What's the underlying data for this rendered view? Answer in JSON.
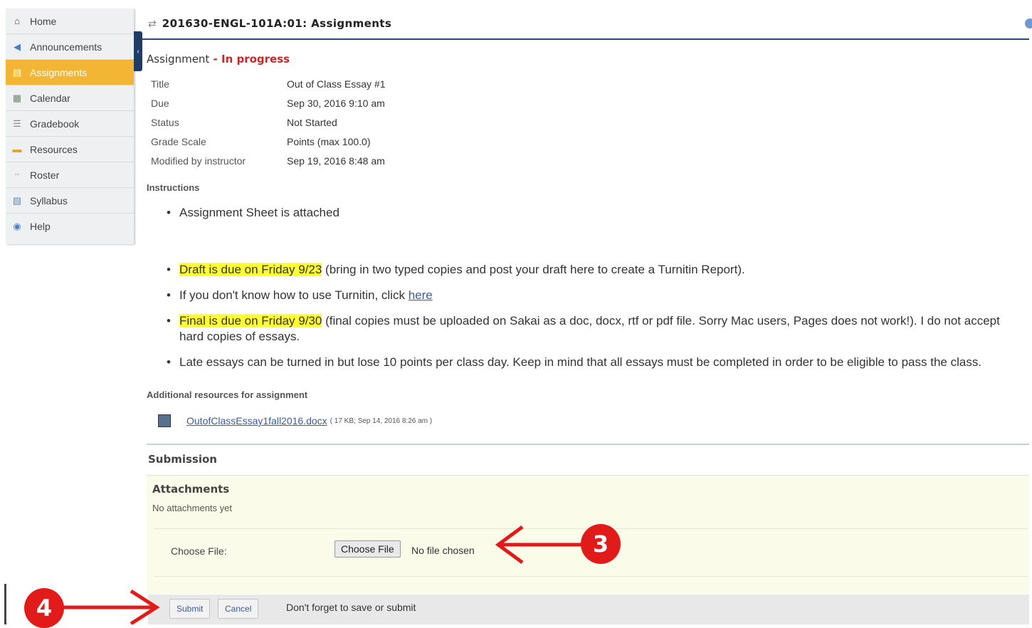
{
  "sidebar": {
    "items": [
      {
        "label": "Home",
        "icon": "home-icon",
        "active": false
      },
      {
        "label": "Announcements",
        "icon": "megaphone-icon",
        "active": false
      },
      {
        "label": "Assignments",
        "icon": "assignment-icon",
        "active": true
      },
      {
        "label": "Calendar",
        "icon": "calendar-icon",
        "active": false
      },
      {
        "label": "Gradebook",
        "icon": "gradebook-icon",
        "active": false
      },
      {
        "label": "Resources",
        "icon": "folder-icon",
        "active": false
      },
      {
        "label": "Roster",
        "icon": "roster-icon",
        "active": false
      },
      {
        "label": "Syllabus",
        "icon": "syllabus-icon",
        "active": false
      },
      {
        "label": "Help",
        "icon": "help-icon",
        "active": false
      }
    ]
  },
  "header": {
    "title": "201630-ENGL-101A:01: Assignments"
  },
  "assignment": {
    "label": "Assignment",
    "separator": " - ",
    "status": "In progress",
    "meta": [
      {
        "key": "Title",
        "value": "Out of Class Essay #1"
      },
      {
        "key": "Due",
        "value": "Sep 30, 2016 9:10 am"
      },
      {
        "key": "Status",
        "value": "Not Started"
      },
      {
        "key": "Grade Scale",
        "value": "Points (max 100.0)"
      },
      {
        "key": "Modified by instructor",
        "value": "Sep 19, 2016 8:48 am"
      }
    ],
    "instructions_label": "Instructions",
    "bullets": {
      "b1": "Assignment Sheet is attached",
      "b2_hl": "Draft is due on Friday 9/23",
      "b2_rest": " (bring in two typed copies and post your draft here to create a Turnitin Report).",
      "b3_text": "If you don't know how to use Turnitin, click ",
      "b3_link": "here",
      "b4_hl": "Final is due on Friday 9/30",
      "b4_rest": " (final copies must be uploaded on Sakai as a doc, docx, rtf or pdf file. Sorry Mac users, Pages does not work!). I do not accept hard copies of essays.",
      "b5": "Late essays can be turned in but lose 10 points per class day. Keep in mind that all essays must be completed in order to be eligible to pass the class."
    },
    "additional_label": "Additional resources for assignment",
    "file": {
      "name": "OutofClassEssay1fall2016.docx",
      "meta": "( 17 KB; Sep 14, 2016 8:26 am )"
    }
  },
  "submission": {
    "label": "Submission",
    "attachments_label": "Attachments",
    "no_attachments": "No attachments yet",
    "choose_label": "Choose File:",
    "choose_button": "Choose File",
    "no_file": "No file chosen",
    "submit": "Submit",
    "cancel": "Cancel",
    "reminder": "Don't forget to save or submit"
  },
  "annotations": {
    "step3": "3",
    "step4": "4"
  },
  "colors": {
    "accent": "#f3b534",
    "header_rule": "#2b4a78",
    "status": "#c62828",
    "highlight": "#ffff33",
    "annotation": "#e11a1a"
  }
}
